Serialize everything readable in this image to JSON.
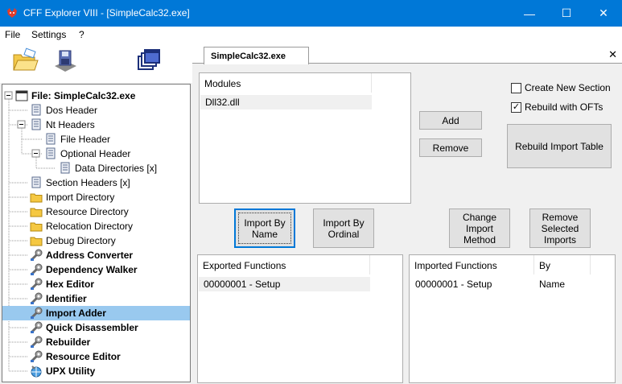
{
  "window": {
    "title": "CFF Explorer VIII - [SimpleCalc32.exe]",
    "minimize_glyph": "—",
    "maximize_glyph": "☐",
    "close_glyph": "✕",
    "accent_color": "#0078d7"
  },
  "menu": {
    "items": [
      "File",
      "Settings",
      "?"
    ]
  },
  "toolbar": {
    "icons": [
      "open-file-icon",
      "save-file-icon",
      "windows-icon"
    ]
  },
  "tree": {
    "items": [
      {
        "label": "File: SimpleCalc32.exe",
        "icon": "file-icon",
        "bold": true
      },
      {
        "label": "Dos Header",
        "icon": "document-icon"
      },
      {
        "label": "Nt Headers",
        "icon": "document-icon"
      },
      {
        "label": "File Header",
        "icon": "document-icon"
      },
      {
        "label": "Optional Header",
        "icon": "document-icon"
      },
      {
        "label": "Data Directories [x]",
        "icon": "document-icon"
      },
      {
        "label": "Section Headers [x]",
        "icon": "document-icon"
      },
      {
        "label": "Import Directory",
        "icon": "folder-icon"
      },
      {
        "label": "Resource Directory",
        "icon": "folder-icon"
      },
      {
        "label": "Relocation Directory",
        "icon": "folder-icon"
      },
      {
        "label": "Debug Directory",
        "icon": "folder-icon"
      },
      {
        "label": "Address Converter",
        "icon": "tool-icon",
        "bold": true
      },
      {
        "label": "Dependency Walker",
        "icon": "tool-icon",
        "bold": true
      },
      {
        "label": "Hex Editor",
        "icon": "tool-icon",
        "bold": true
      },
      {
        "label": "Identifier",
        "icon": "tool-icon",
        "bold": true
      },
      {
        "label": "Import Adder",
        "icon": "tool-icon",
        "bold": true,
        "selected": true
      },
      {
        "label": "Quick Disassembler",
        "icon": "tool-icon",
        "bold": true
      },
      {
        "label": "Rebuilder",
        "icon": "tool-icon",
        "bold": true
      },
      {
        "label": "Resource Editor",
        "icon": "tool-icon",
        "bold": true
      },
      {
        "label": "UPX Utility",
        "icon": "globe-tool-icon",
        "bold": true
      }
    ],
    "selection_color": "#99c9ef"
  },
  "tab": {
    "label": "SimpleCalc32.exe",
    "close_glyph": "✕"
  },
  "modules": {
    "header": "Modules",
    "rows": [
      "Dll32.dll"
    ]
  },
  "buttons": {
    "add": "Add",
    "remove": "Remove",
    "rebuild_import_table": "Rebuild Import Table",
    "import_by_name": "Import By\nName",
    "import_by_ordinal": "Import By\nOrdinal",
    "change_import_method": "Change\nImport\nMethod",
    "remove_selected_imports": "Remove\nSelected\nImports"
  },
  "options": {
    "create_new_section": {
      "label": "Create New Section",
      "checked": false
    },
    "rebuild_with_ofts": {
      "label": "Rebuild with OFTs",
      "checked": true
    }
  },
  "exported": {
    "header": "Exported Functions",
    "rows": [
      "00000001 - Setup"
    ]
  },
  "imported": {
    "header_functions": "Imported Functions",
    "header_by": "By",
    "rows": [
      {
        "function": "00000001 - Setup",
        "by": "Name"
      }
    ]
  }
}
